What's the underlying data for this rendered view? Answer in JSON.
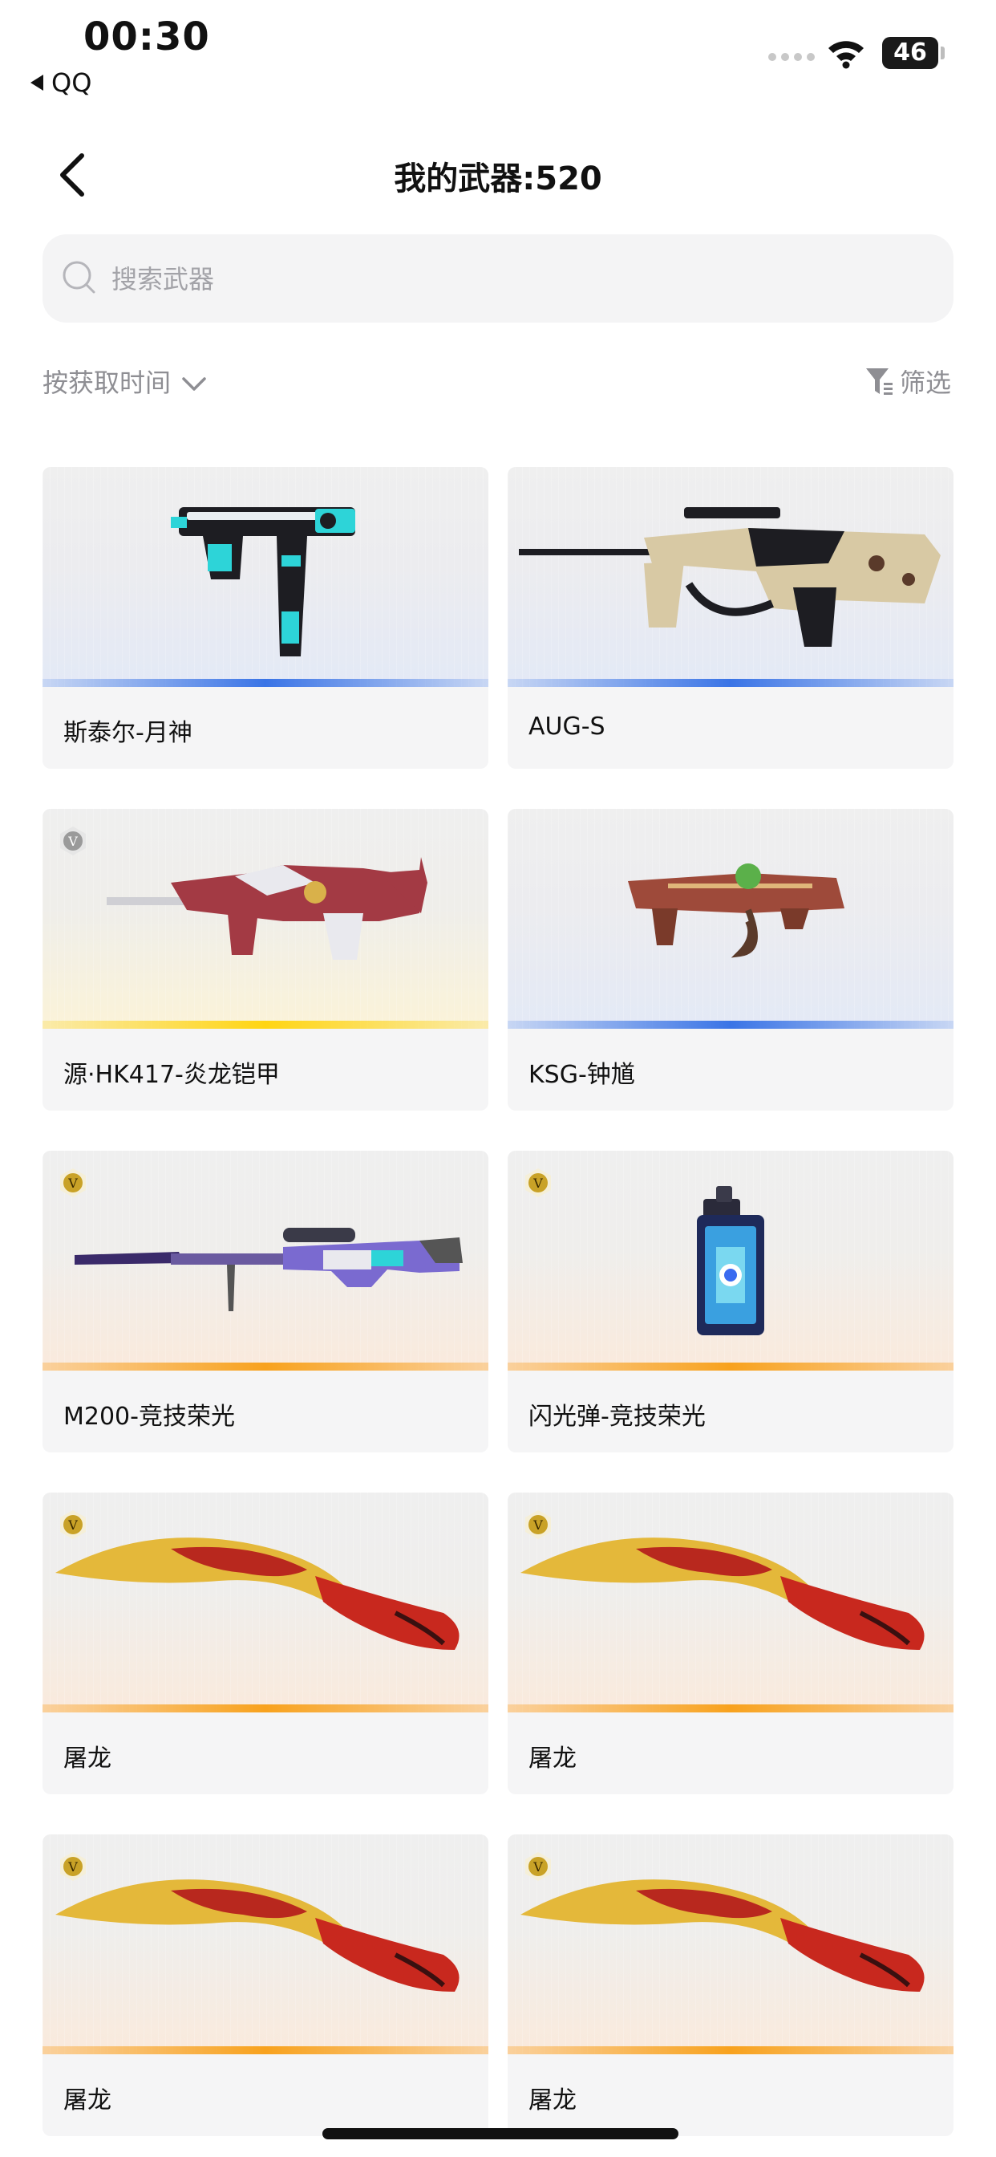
{
  "status_bar": {
    "time": "00:30",
    "back_app": "QQ",
    "battery": "46",
    "icons": [
      "cellular-signal-icon",
      "wifi-icon",
      "battery-icon"
    ]
  },
  "header": {
    "title": "我的武器:520",
    "back_icon": "chevron-left-icon"
  },
  "search": {
    "placeholder": "搜索武器",
    "value": "",
    "icon": "search-icon"
  },
  "toolbar": {
    "sort_label": "按获取时间",
    "sort_icon": "chevron-down-icon",
    "filter_label": "筛选",
    "filter_icon": "filter-icon"
  },
  "colors": {
    "rarity_blue": "#3a74e6",
    "rarity_gold": "#ffd513",
    "rarity_orange": "#f8a21e",
    "badge_gold": "#c9a227",
    "badge_gray": "#9a9a9a"
  },
  "weapons": [
    {
      "name": "斯泰尔-月神",
      "rarity": "blue",
      "badge": "",
      "icon": "smg-icon"
    },
    {
      "name": "AUG-S",
      "rarity": "blue",
      "badge": "",
      "icon": "rifle-icon"
    },
    {
      "name": "源·HK417-炎龙铠甲",
      "rarity": "gold",
      "badge": "V",
      "icon": "rifle-icon"
    },
    {
      "name": "KSG-钟馗",
      "rarity": "blue",
      "badge": "",
      "icon": "shotgun-icon"
    },
    {
      "name": "M200-竞技荣光",
      "rarity": "orange",
      "badge": "V",
      "icon": "sniper-rifle-icon"
    },
    {
      "name": "闪光弹-竞技荣光",
      "rarity": "orange",
      "badge": "V",
      "icon": "flashbang-icon"
    },
    {
      "name": "屠龙",
      "rarity": "orange",
      "badge": "V",
      "icon": "kukri-knife-icon"
    },
    {
      "name": "屠龙",
      "rarity": "orange",
      "badge": "V",
      "icon": "kukri-knife-icon"
    },
    {
      "name": "屠龙",
      "rarity": "orange",
      "badge": "V",
      "icon": "kukri-knife-icon"
    },
    {
      "name": "屠龙",
      "rarity": "orange",
      "badge": "V",
      "icon": "kukri-knife-icon"
    }
  ]
}
